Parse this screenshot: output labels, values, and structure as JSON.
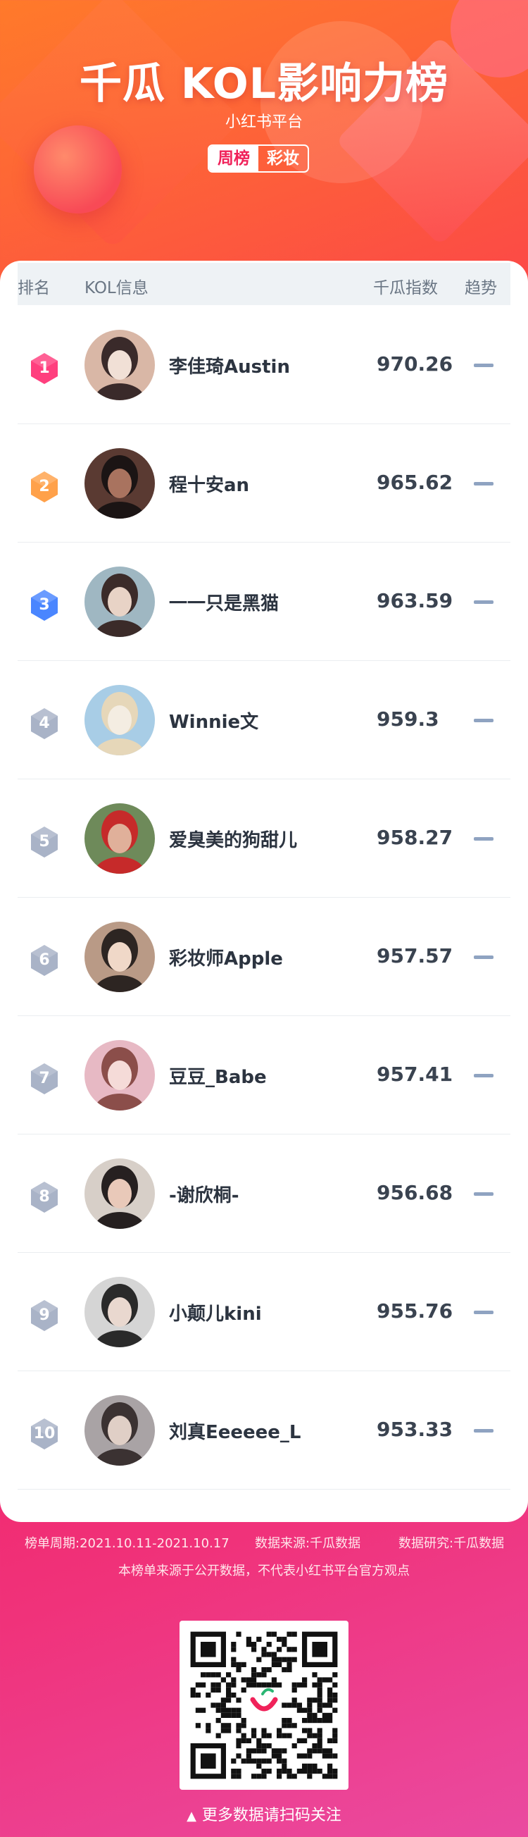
{
  "header": {
    "title": "千瓜 KOL影响力榜",
    "subtitle": "小红书平台",
    "tags": [
      "周榜",
      "彩妆"
    ]
  },
  "table": {
    "columns": [
      "排名",
      "KOL信息",
      "千瓜指数",
      "趋势"
    ],
    "rows": [
      {
        "rank": "1",
        "name": "李佳琦Austin",
        "score": "970.26",
        "trend": "flat",
        "badge_color": "#ff3f7e"
      },
      {
        "rank": "2",
        "name": "程十安an",
        "score": "965.62",
        "trend": "flat",
        "badge_color": "#ffa14a"
      },
      {
        "rank": "3",
        "name": "一一只是黑猫",
        "score": "963.59",
        "trend": "flat",
        "badge_color": "#4a86ff"
      },
      {
        "rank": "4",
        "name": "Winnie文",
        "score": "959.3",
        "trend": "flat",
        "badge_color": "#a9b3c7"
      },
      {
        "rank": "5",
        "name": "爱臭美的狗甜儿",
        "score": "958.27",
        "trend": "flat",
        "badge_color": "#a9b3c7"
      },
      {
        "rank": "6",
        "name": "彩妆师Apple",
        "score": "957.57",
        "trend": "flat",
        "badge_color": "#a9b3c7"
      },
      {
        "rank": "7",
        "name": "豆豆_Babe",
        "score": "957.41",
        "trend": "flat",
        "badge_color": "#a9b3c7"
      },
      {
        "rank": "8",
        "name": "-谢欣桐-",
        "score": "956.68",
        "trend": "flat",
        "badge_color": "#a9b3c7"
      },
      {
        "rank": "9",
        "name": "小颠儿kini",
        "score": "955.76",
        "trend": "flat",
        "badge_color": "#a9b3c7"
      },
      {
        "rank": "10",
        "name": "刘真Eeeeee_L",
        "score": "953.33",
        "trend": "flat",
        "badge_color": "#a9b3c7"
      }
    ]
  },
  "footer": {
    "period": "榜单周期:2021.10.11-2021.10.17",
    "source": "数据来源:千瓜数据",
    "research": "数据研究:千瓜数据",
    "note": "本榜单来源于公开数据，不代表小红书平台官方观点",
    "qr_caption": "更多数据请扫码关注"
  }
}
